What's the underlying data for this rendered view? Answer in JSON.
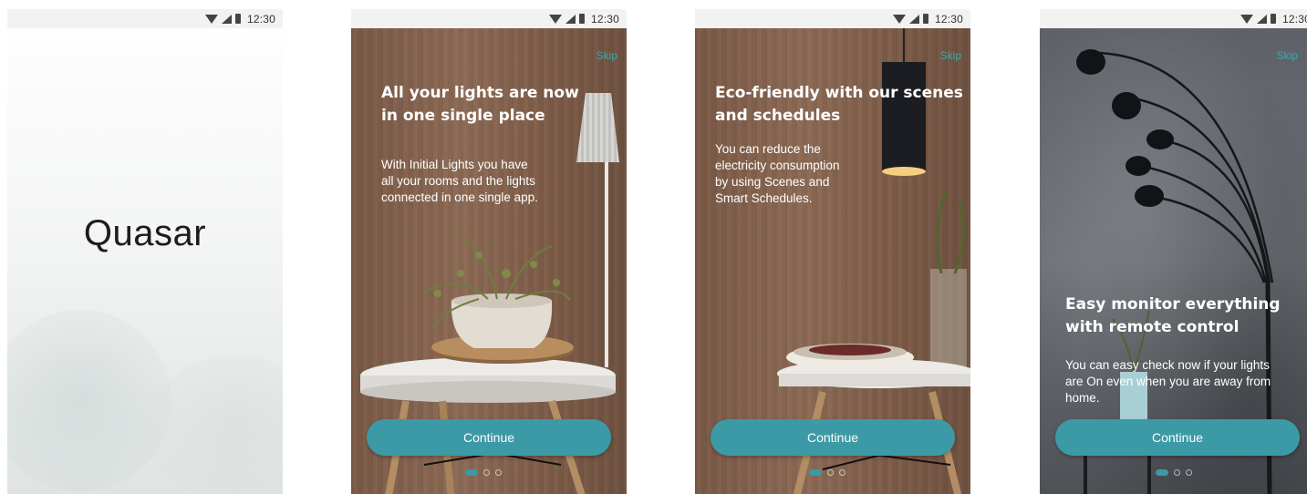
{
  "status_bar": {
    "time": "12:30"
  },
  "screen1": {
    "logo": "Quasar"
  },
  "screen2": {
    "skip": "Skip",
    "heading_line1": "All your lights are now",
    "heading_line2": "in one single place",
    "body_line1": "With Initial Lights you have",
    "body_line2": "all your rooms and the lights",
    "body_line3": "connected in one single app.",
    "button": "Continue",
    "page_indicator": {
      "pages": 3,
      "active": 1
    }
  },
  "screen3": {
    "skip": "Skip",
    "heading_line1": "Eco-friendly with our scenes",
    "heading_line2": "and schedules",
    "body_line1": "You can reduce the",
    "body_line2": "electricity consumption",
    "body_line3": "by using Scenes and",
    "body_line4": "Smart Schedules.",
    "button": "Continue",
    "page_indicator": {
      "pages": 3,
      "active": 1
    }
  },
  "screen4": {
    "skip": "Skip",
    "heading_line1": "Easy monitor everything",
    "heading_line2": "with remote control",
    "body_line1": "You can easy check now if your lights",
    "body_line2": "are On even when you are away from",
    "body_line3": "home.",
    "button": "Continue",
    "page_indicator": {
      "pages": 3,
      "active": 1
    }
  },
  "colors": {
    "accent": "#3b9aa5",
    "skip_text": "#3fa5ad"
  }
}
